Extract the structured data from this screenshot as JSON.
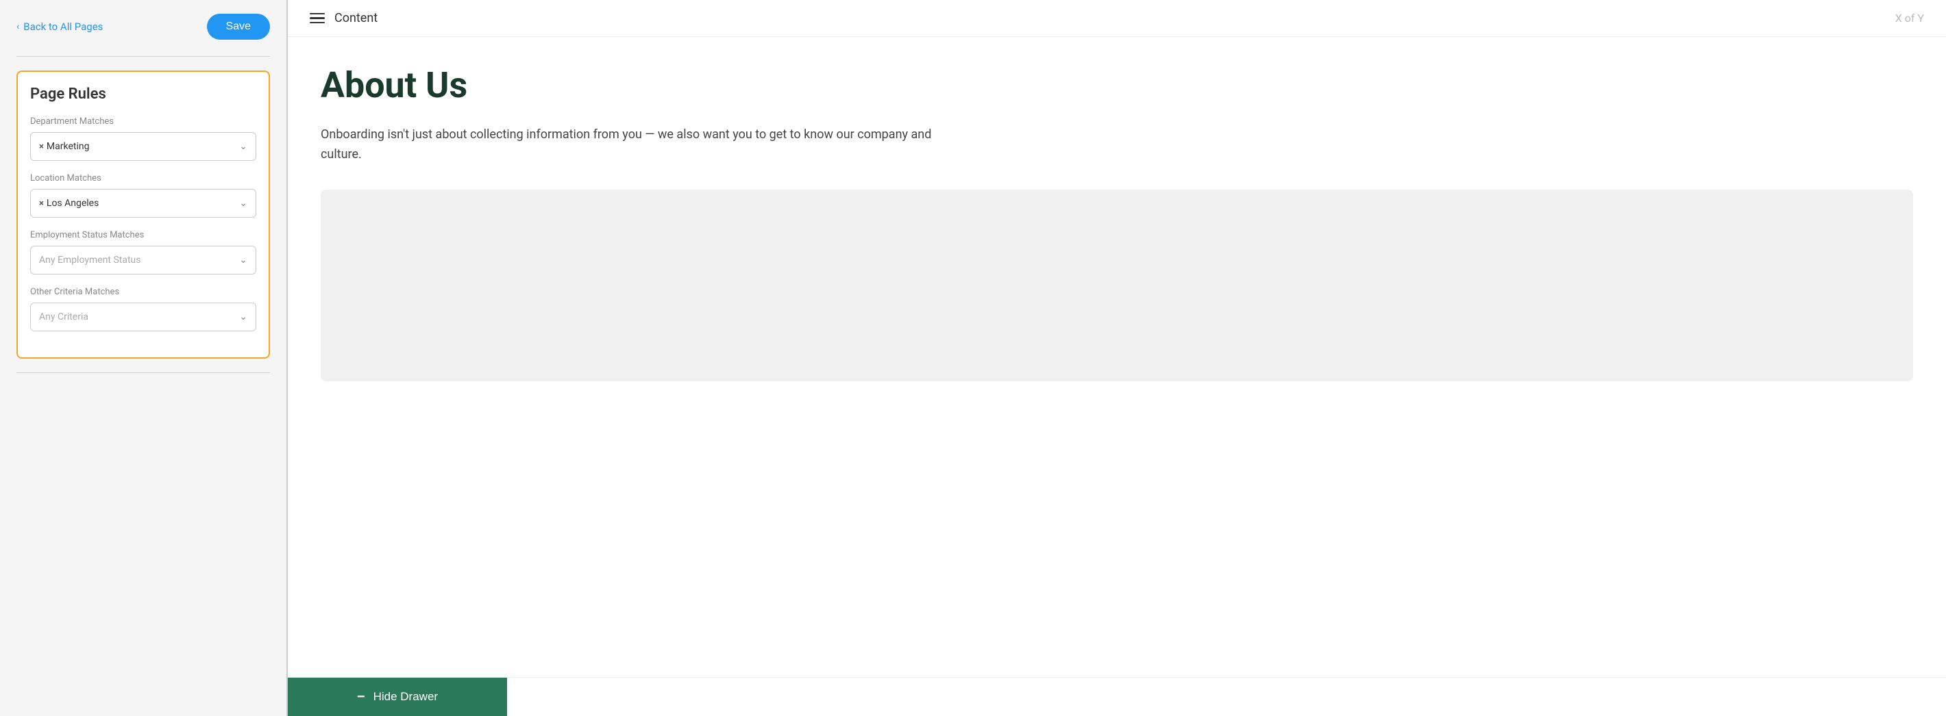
{
  "sidebar": {
    "back_label": "Back to All Pages",
    "save_label": "Save",
    "page_rules": {
      "title": "Page Rules",
      "department": {
        "label": "Department Matches",
        "value": "Marketing"
      },
      "location": {
        "label": "Location Matches",
        "value": "Los Angeles"
      },
      "employment_status": {
        "label": "Employment Status Matches",
        "placeholder": "Any Employment Status"
      },
      "other_criteria": {
        "label": "Other Criteria Matches",
        "placeholder": "Any Criteria"
      }
    }
  },
  "topbar": {
    "content_label": "Content",
    "pagination": "X of Y"
  },
  "main": {
    "page_title": "About Us",
    "page_description": "Onboarding isn't just about collecting information from you — we also want you to get to know our company and culture."
  },
  "bottom": {
    "hide_drawer_label": "Hide Drawer",
    "minus_icon": "−"
  }
}
